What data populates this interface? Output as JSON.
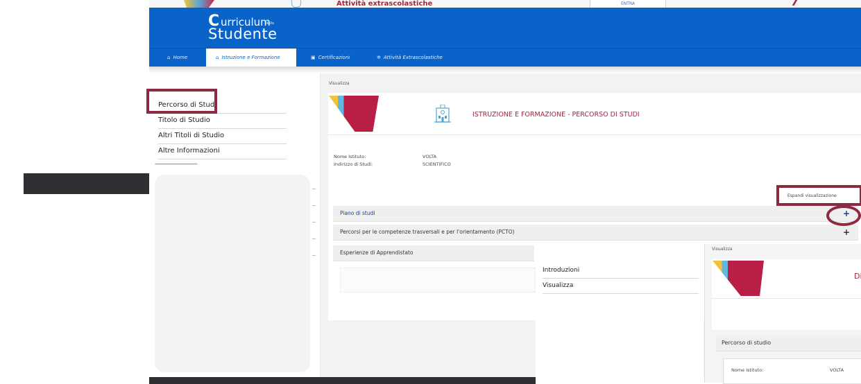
{
  "top_crop": {
    "label": "Attività extrascolastiche",
    "box_label": "ENTRA"
  },
  "brand": {
    "word1": "urriculum",
    "small": "dello",
    "word2": "tudente",
    "c": "C",
    "s": "S"
  },
  "nav": {
    "items": [
      {
        "icon": "home-icon",
        "glyph": "⌂",
        "label": "Home"
      },
      {
        "icon": "school-icon",
        "glyph": "⌂",
        "label": "Istruzione e Formazione"
      },
      {
        "icon": "certificate-icon",
        "glyph": "▣",
        "label": "Certificazioni"
      },
      {
        "icon": "gear-icon",
        "glyph": "✲",
        "label": "Attività Extrascolastiche"
      }
    ]
  },
  "sidebar": {
    "items": [
      "Percorso di Studi",
      "Titolo di Studio",
      "Altri Titoli di Studio",
      "Altre Informazioni"
    ],
    "dashes": "----------------------------------------"
  },
  "main": {
    "breadcrumb": "Visualizza",
    "title": "ISTRUZIONE E FORMAZIONE - PERCORSO DI STUDI",
    "fields": [
      {
        "label": "Nome Istituto:",
        "value": "VOLTA"
      },
      {
        "label": "Indirizzo di Studi:",
        "value": "SCIENTIFICO"
      }
    ],
    "expand_link": "Espandi visualizzazione",
    "sections": [
      {
        "title": "Piano di studi",
        "plus": "+"
      },
      {
        "title": "Percorsi per le competenze trasversali e per l'orientamento (PCTO)",
        "plus": "+"
      },
      {
        "title": "Esperienze di Apprendistato"
      }
    ]
  },
  "overlay_menu": {
    "items": [
      "Introduzioni",
      "Visualizza"
    ]
  },
  "overlay_right": {
    "breadcrumb": "Visualizza",
    "title_fragment": "Di",
    "section": "Percorso di studio",
    "row": {
      "label": "Nome Istituto:",
      "value": "VOLTA"
    }
  },
  "colors": {
    "header_blue": "#0a63c9",
    "highlight": "#8e2942",
    "title_red": "#b01e3a"
  }
}
